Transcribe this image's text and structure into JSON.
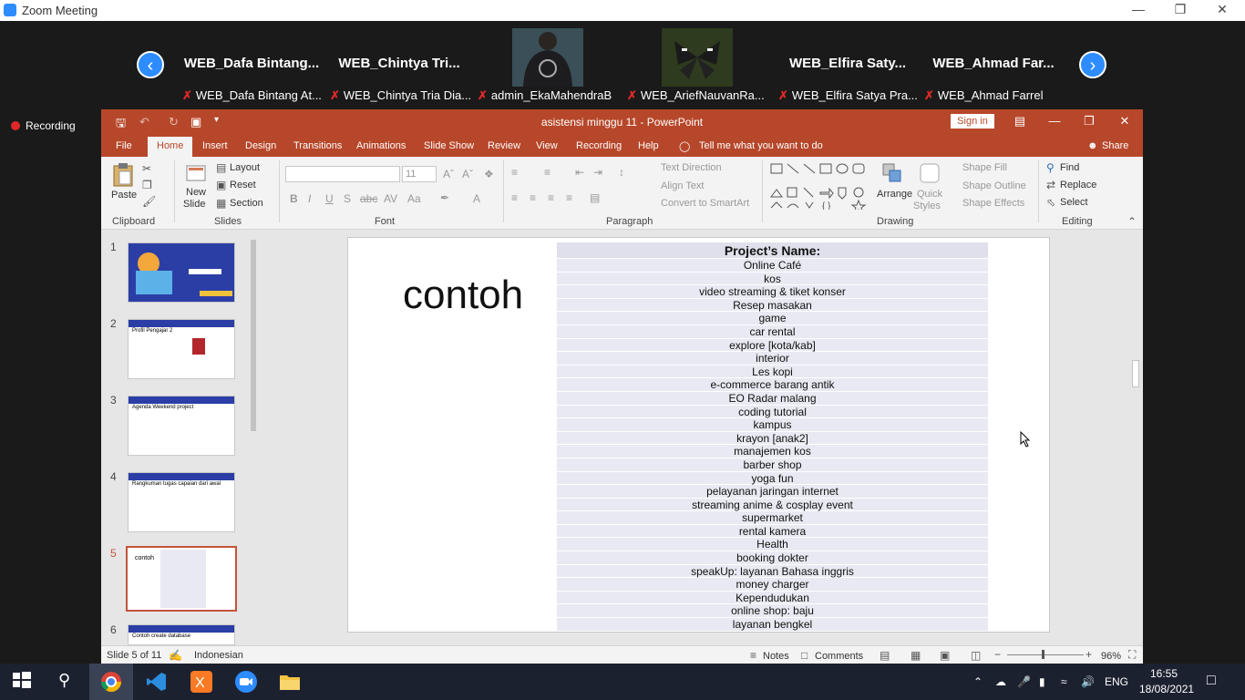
{
  "zoom": {
    "window_title": "Zoom Meeting",
    "recording_label": "Recording",
    "tiles": [
      {
        "name": "WEB_Dafa  Bintang...",
        "label": "WEB_Dafa Bintang At..."
      },
      {
        "name": "WEB_Chintya  Tri...",
        "label": "WEB_Chintya Tria Dia..."
      },
      {
        "name": "",
        "label": "admin_EkaMahendraB"
      },
      {
        "name": "",
        "label": "WEB_AriefNauvanRa..."
      },
      {
        "name": "WEB_Elfira  Saty...",
        "label": "WEB_Elfira Satya Pra..."
      },
      {
        "name": "WEB_Ahmad  Far...",
        "label": "WEB_Ahmad Farrel"
      }
    ]
  },
  "ppt": {
    "title": "asistensi minggu 11  -  PowerPoint",
    "sign_in": "Sign in",
    "tabs": [
      "File",
      "Home",
      "Insert",
      "Design",
      "Transitions",
      "Animations",
      "Slide Show",
      "Review",
      "View",
      "Recording",
      "Help"
    ],
    "tell_me": "Tell me what you want to do",
    "share": "Share",
    "ribbon": {
      "paste": "Paste",
      "clipboard": "Clipboard",
      "layout": "Layout",
      "reset": "Reset",
      "new_slide_1": "New",
      "new_slide_2": "Slide",
      "section": "Section",
      "slides": "Slides",
      "font_size": "11",
      "font": "Font",
      "text_direction": "Text Direction",
      "align_text": "Align Text",
      "convert_smartart": "Convert to SmartArt",
      "paragraph": "Paragraph",
      "arrange": "Arrange",
      "quick_styles_1": "Quick",
      "quick_styles_2": "Styles",
      "shape_fill": "Shape Fill",
      "shape_outline": "Shape Outline",
      "shape_effects": "Shape Effects",
      "drawing": "Drawing",
      "find": "Find",
      "replace": "Replace",
      "select": "Select",
      "editing": "Editing"
    },
    "thumb_numbers": [
      "1",
      "2",
      "3",
      "4",
      "5",
      "6"
    ],
    "thumb_texts": {
      "t2": "Profil Pengajar 2",
      "t3": "Agenda Weekend project",
      "t4": "Rangkuman tugas capaian dari awal",
      "t5": "contoh",
      "t6": "Contoh create database"
    },
    "slide": {
      "heading": "contoh",
      "table_header": "Project’s Name:",
      "projects": [
        "Online Café",
        "kos",
        "video streaming & tiket konser",
        "Resep masakan",
        "game",
        "car rental",
        "explore [kota/kab]",
        "interior",
        "Les kopi",
        "e-commerce barang antik",
        "EO Radar malang",
        "coding tutorial",
        "kampus",
        "krayon [anak2]",
        "manajemen kos",
        "barber shop",
        "yoga fun",
        "pelayanan jaringan internet",
        "streaming anime & cosplay event",
        "supermarket",
        "rental kamera",
        "Health",
        "booking dokter",
        "speakUp: layanan Bahasa inggris",
        "money charger",
        "Kependudukan",
        "online shop: baju",
        "layanan bengkel"
      ]
    },
    "status": {
      "slide_of": "Slide 5 of 11",
      "language": "Indonesian",
      "notes": "Notes",
      "comments": "Comments",
      "zoom": "96%"
    }
  },
  "taskbar": {
    "lang": "ENG",
    "time": "16:55",
    "date": "18/08/2021"
  },
  "colors": {
    "ppt_accent": "#b7472a",
    "zoom_blue": "#2d8cff",
    "taskbar": "#1c2130"
  }
}
